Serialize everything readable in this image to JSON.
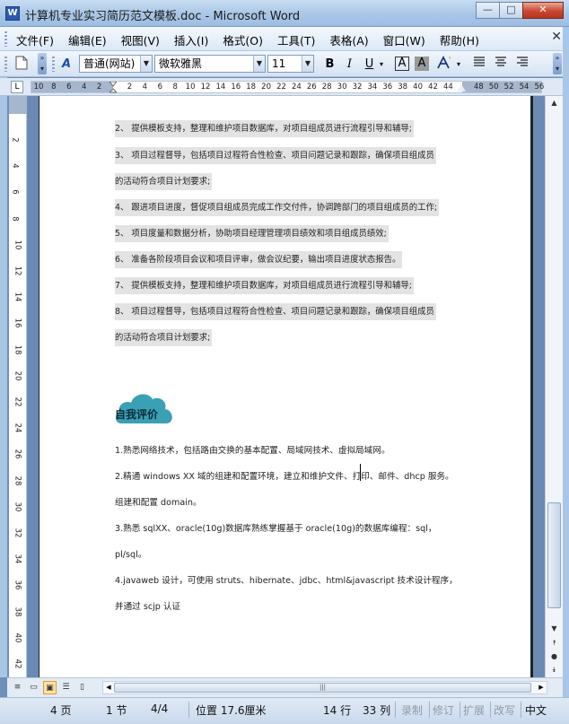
{
  "window": {
    "app_icon": "W",
    "title": "计算机专业实习简历范文模板.doc - Microsoft Word",
    "min": "—",
    "max": "□",
    "close": "✕"
  },
  "menu": {
    "items": [
      "文件(F)",
      "编辑(E)",
      "视图(V)",
      "插入(I)",
      "格式(O)",
      "工具(T)",
      "表格(A)",
      "窗口(W)",
      "帮助(H)"
    ],
    "close_doc": "✕"
  },
  "toolbar": {
    "style_value": "普通(网站)",
    "font_value": "微软雅黑",
    "size_value": "11",
    "bold": "B",
    "italic": "I",
    "underline": "U",
    "char_border": "A",
    "char_shading": "A",
    "style_glyph": "A"
  },
  "ruler": {
    "tab_selector": "L",
    "h_labels": [
      "10",
      "8",
      "6",
      "4",
      "2",
      "2",
      "4",
      "6",
      "8",
      "10",
      "12",
      "14",
      "16",
      "18",
      "20",
      "22",
      "24",
      "26",
      "28",
      "30",
      "32",
      "34",
      "36",
      "38",
      "40",
      "42",
      "44",
      "48",
      "50",
      "52",
      "54",
      "56"
    ],
    "v_labels": [
      "2",
      "4",
      "6",
      "8",
      "10",
      "12",
      "14",
      "16",
      "18",
      "20",
      "22",
      "24",
      "26",
      "28",
      "30",
      "32",
      "34",
      "36",
      "38",
      "40",
      "42"
    ]
  },
  "document": {
    "lines": [
      "2、 提供模板支持，整理和维护项目数据库，对项目组成员进行流程引导和辅导;",
      "3、 项目过程督导，包括项目过程符合性检查、项目问题记录和跟踪，确保项目组成员",
      "的活动符合项目计划要求;",
      "4、 跟进项目进度，督促项目组成员完成工作交付件，协调跨部门的项目组成员的工作;",
      "5、 项目度量和数据分析，协助项目经理管理项目绩效和项目组成员绩效;",
      "6、 准备各阶段项目会议和项目评审，做会议纪要，输出项目进度状态报告。",
      "7、 提供模板支持，整理和维护项目数据库，对项目组成员进行流程引导和辅导;",
      "8、 项目过程督导，包括项目过程符合性检查、项目问题记录和跟踪，确保项目组成员",
      "的活动符合项目计划要求;"
    ],
    "section_heading": "自我评价",
    "cloud_color": "#3aa0b4",
    "eval_lines": [
      "1.熟悉网络技术，包括路由交换的基本配置、局域网技术、虚拟局域网。",
      "2.精通 windows XX 域的组建和配置环境，建立和维护文件、打印、邮件、dhcp 服务。",
      "组建和配置 domain。",
      "3.熟悉 sqlXX、oracle(10g)数据库熟练掌握基于 oracle(10g)的数据库编程：sql，",
      "pl/sql。",
      "4.javaweb 设计，可使用 struts、hibernate、jdbc、html&javascript 技术设计程序，",
      "并通过 scjp 认证"
    ]
  },
  "scrollbar": {
    "up": "▲",
    "down": "▼",
    "prev_page": "⯭",
    "select_browse": "●",
    "next_page": "⯯",
    "h_grip": "|||"
  },
  "status": {
    "page": "4 页",
    "section": "1 节",
    "page_of": "4/4",
    "position": "位置 17.6厘米",
    "line": "14 行",
    "column": "33 列",
    "rec": "录制",
    "trk": "修订",
    "ext": "扩展",
    "ovr": "改写",
    "lang": "中文"
  }
}
